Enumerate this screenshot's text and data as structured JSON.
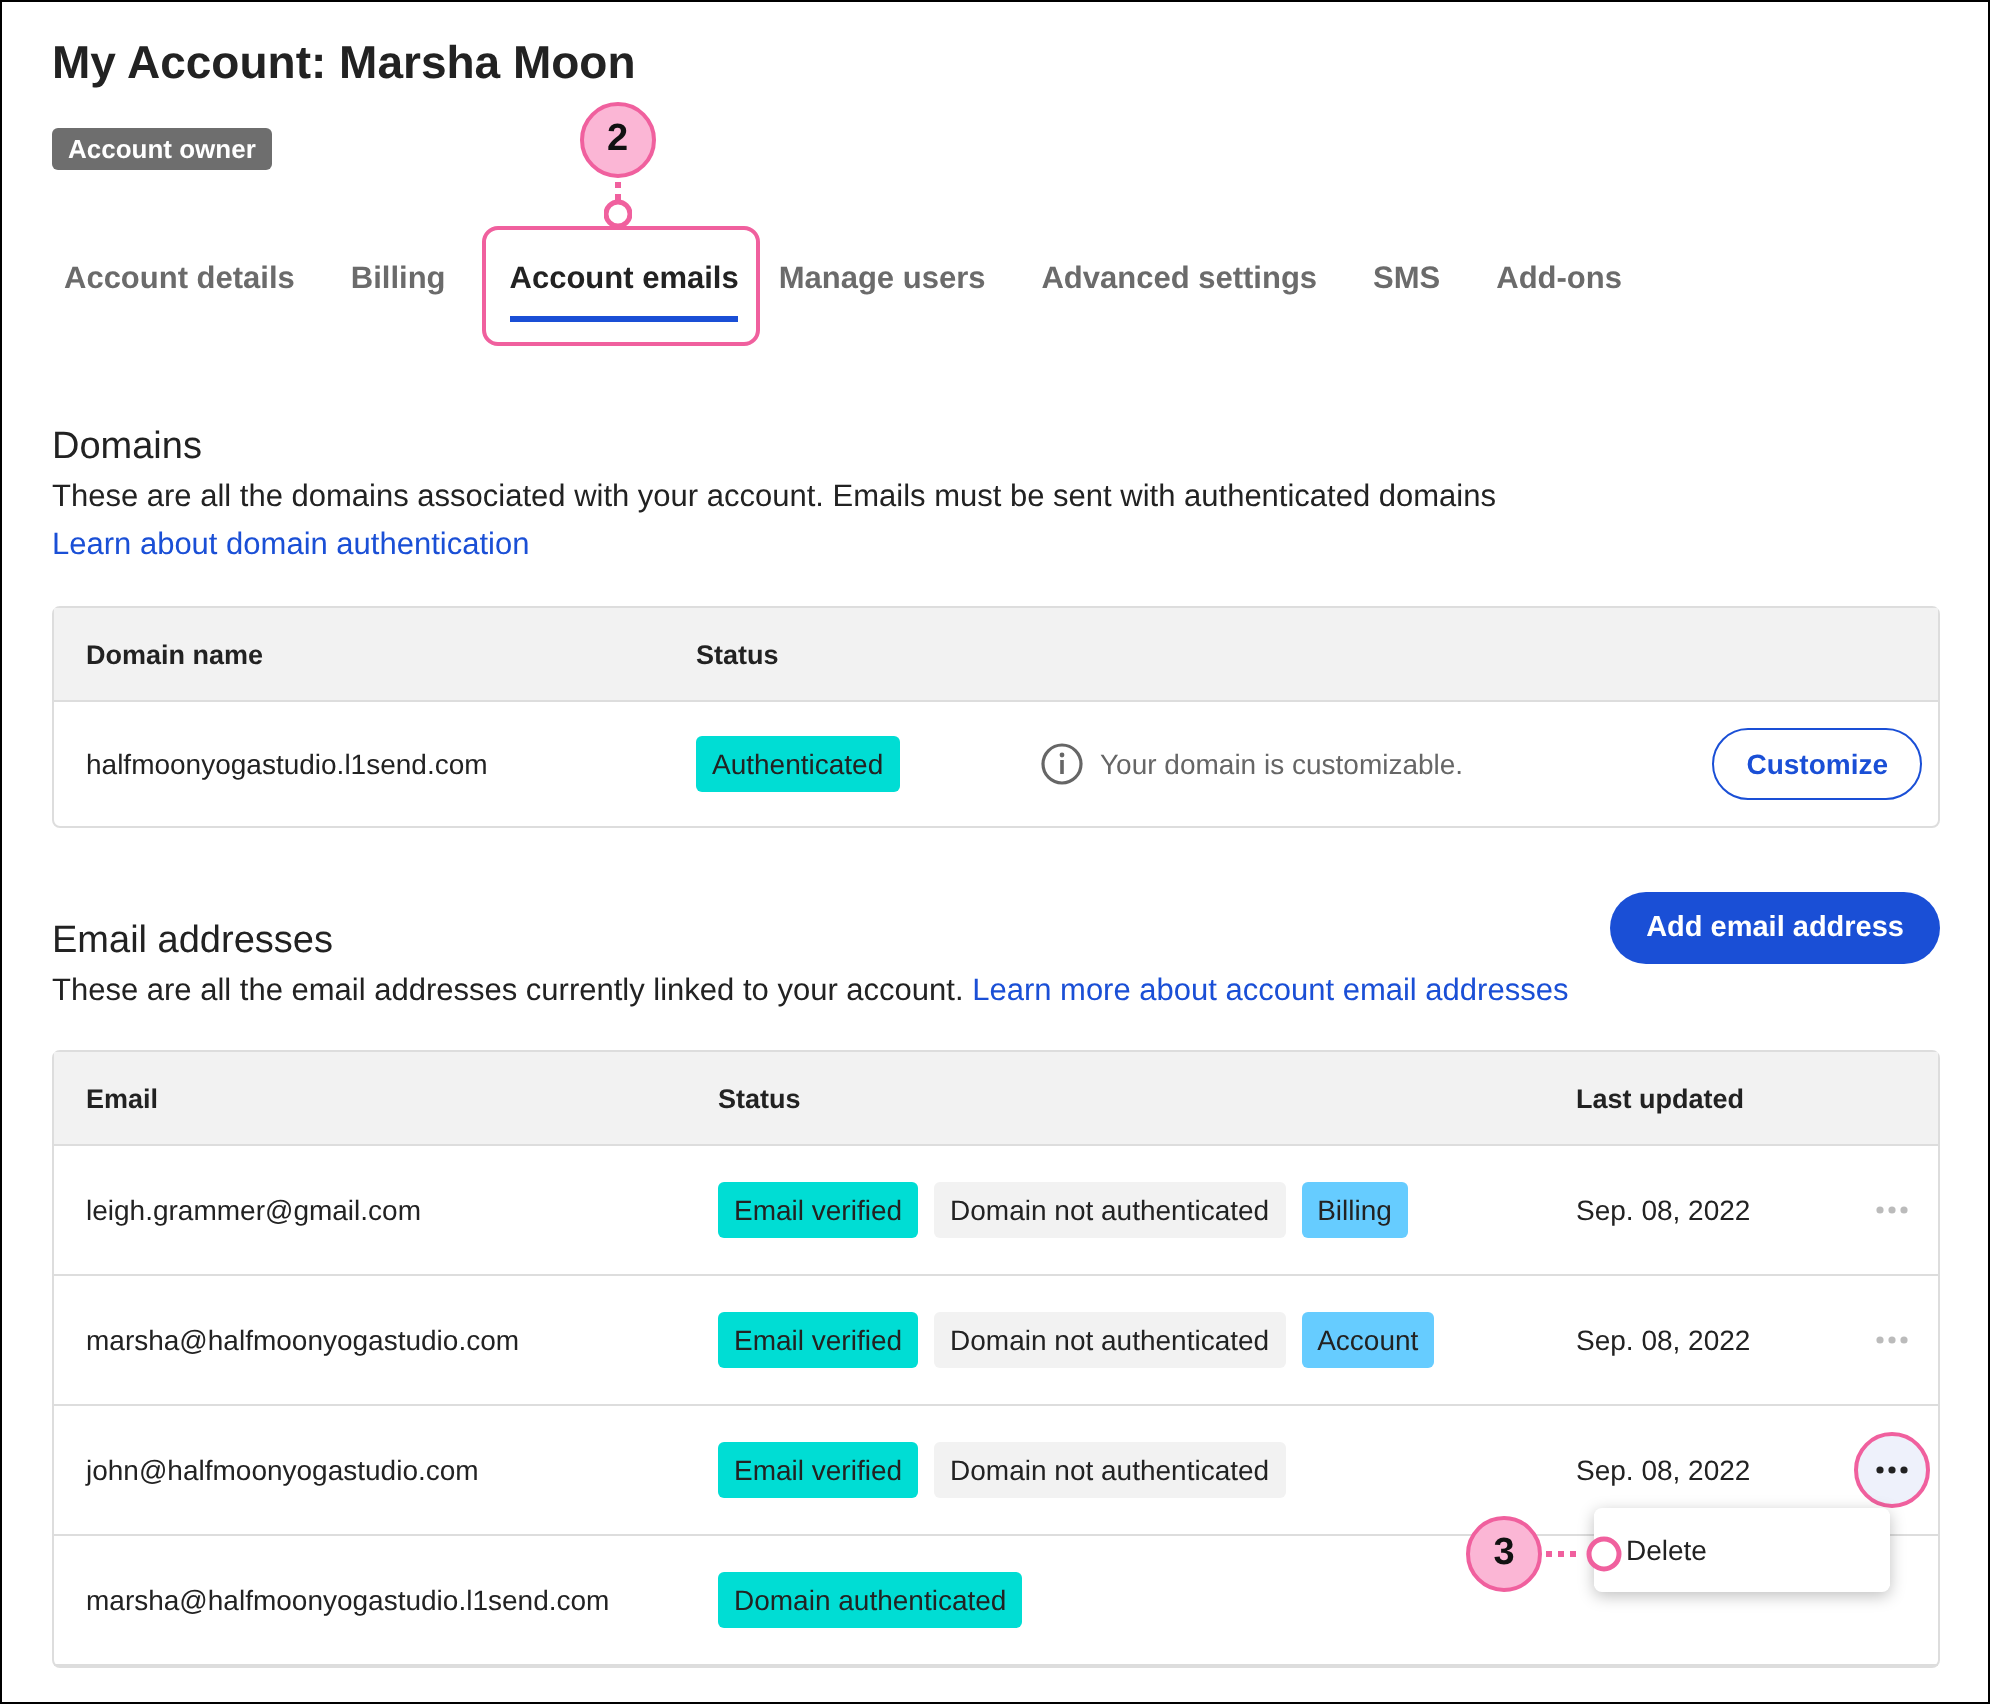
{
  "title": "My Account: Marsha Moon",
  "role_badge": "Account owner",
  "tabs": [
    {
      "label": "Account details",
      "selected": false
    },
    {
      "label": "Billing",
      "selected": false
    },
    {
      "label": "Account emails",
      "selected": true,
      "callout": "2"
    },
    {
      "label": "Manage users",
      "selected": false
    },
    {
      "label": "Advanced settings",
      "selected": false
    },
    {
      "label": "SMS",
      "selected": false
    },
    {
      "label": "Add-ons",
      "selected": false
    }
  ],
  "domains": {
    "heading": "Domains",
    "description": "These are all the domains associated with your account. Emails must be sent with authenticated domains ",
    "link": "Learn about domain authentication",
    "columns": [
      "Domain name",
      "Status"
    ],
    "rows": [
      {
        "name": "halfmoonyogastudio.l1send.com",
        "status": "Authenticated",
        "note": "Your domain is customizable.",
        "button": "Customize"
      }
    ]
  },
  "emails": {
    "heading": "Email addresses",
    "add_button": "Add email address",
    "description": "These are all the email addresses currently linked to your account. ",
    "link": "Learn more about account email addresses",
    "columns": [
      "Email",
      "Status",
      "Last updated"
    ],
    "rows": [
      {
        "email": "leigh.grammer@gmail.com",
        "tags": [
          {
            "label": "Email verified",
            "kind": "verified"
          },
          {
            "label": "Domain not authenticated",
            "kind": "neutral"
          },
          {
            "label": "Billing",
            "kind": "role"
          }
        ],
        "date": "Sep. 08, 2022",
        "menu_open": false
      },
      {
        "email": "marsha@halfmoonyogastudio.com",
        "tags": [
          {
            "label": "Email verified",
            "kind": "verified"
          },
          {
            "label": "Domain not authenticated",
            "kind": "neutral"
          },
          {
            "label": "Account",
            "kind": "role"
          }
        ],
        "date": "Sep. 08, 2022",
        "menu_open": false
      },
      {
        "email": "john@halfmoonyogastudio.com",
        "tags": [
          {
            "label": "Email verified",
            "kind": "verified"
          },
          {
            "label": "Domain not authenticated",
            "kind": "neutral"
          }
        ],
        "date": "Sep. 08, 2022",
        "menu_open": true
      },
      {
        "email": "marsha@halfmoonyogastudio.l1send.com",
        "tags": [
          {
            "label": "Domain authenticated",
            "kind": "verified"
          }
        ]
      }
    ],
    "menu": {
      "items": [
        {
          "label": "Delete",
          "callout": "3"
        }
      ]
    }
  }
}
